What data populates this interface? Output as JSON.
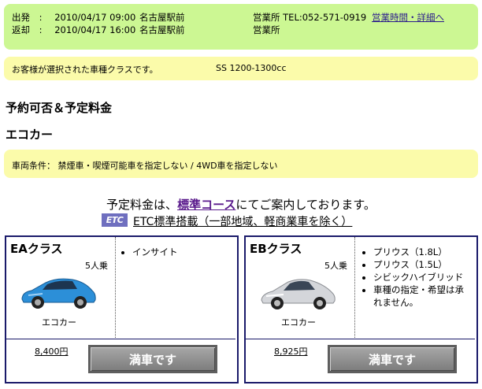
{
  "trip": {
    "pickup_label": "出発",
    "pickup_datetime": "2010/04/17 09:00",
    "pickup_place": "名古屋駅前",
    "return_label": "返却",
    "return_datetime": "2010/04/17 16:00",
    "return_place": "名古屋駅前",
    "office_tel": "営業所 TEL:052-571-0919",
    "office_hours_link": "営業時間・詳細へ",
    "office_return": "営業所"
  },
  "selected_class": {
    "label": "お客様が選択された車種クラスです。",
    "value": "SS 1200-1300cc"
  },
  "section_title": "予約可否＆予定料金",
  "category_title": "エコカー",
  "conditions": {
    "label": "車両条件：",
    "text": "禁煙車・喫煙可能車を指定しない / 4WD車を指定しない"
  },
  "pricing_note": {
    "before": "予定料金は、",
    "link": "標準コース",
    "after": "にてご案内しております。"
  },
  "etc": {
    "badge": "ETC",
    "text": "ETC標準搭載（一部地域、軽商業車を除く）"
  },
  "classes": [
    {
      "name": "EAクラス",
      "capacity": "5人乗",
      "category": "エコカー",
      "features": [
        "インサイト"
      ],
      "price": "8,400円",
      "button": "満車です"
    },
    {
      "name": "EBクラス",
      "capacity": "5人乗",
      "category": "エコカー",
      "features": [
        "プリウス（1.8L）",
        "プリウス（1.5L）",
        "シビックハイブリッド",
        "車種の指定・希望は承れません。"
      ],
      "price": "8,925円",
      "button": "満車です"
    }
  ],
  "colors": {
    "header_green": "#ccf793",
    "info_yellow": "#fbfbaa",
    "box_border": "#1a1a6a",
    "link_purple": "#5a1a8c",
    "car_blue": "#2c8fd8",
    "car_silver": "#d4d6da"
  }
}
